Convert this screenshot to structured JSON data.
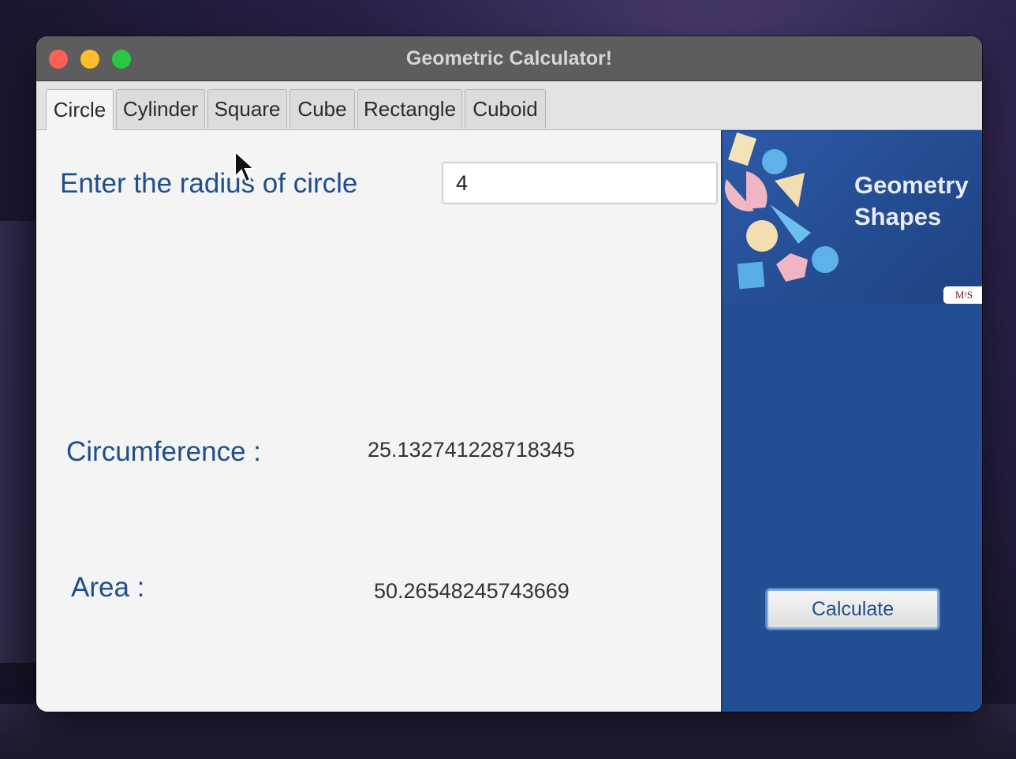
{
  "window": {
    "title": "Geometric Calculator!"
  },
  "tabs": [
    {
      "label": "Circle",
      "active": true
    },
    {
      "label": "Cylinder",
      "active": false
    },
    {
      "label": "Square",
      "active": false
    },
    {
      "label": "Cube",
      "active": false
    },
    {
      "label": "Rectangle",
      "active": false
    },
    {
      "label": "Cuboid",
      "active": false
    }
  ],
  "form": {
    "radius_label": "Enter the radius of circle",
    "radius_value": "4",
    "circumference_label": "Circumference :",
    "circumference_value": "25.132741228718345",
    "area_label": "Area :",
    "area_value": "50.26548245743669"
  },
  "sidebar": {
    "banner_title_line1": "Geometry",
    "banner_title_line2": "Shapes",
    "logo_text": "MᵞS",
    "calculate_label": "Calculate"
  },
  "colors": {
    "accent_blue": "#224f93",
    "label_blue": "#1f4e8c",
    "titlebar": "#5d5d5d"
  }
}
